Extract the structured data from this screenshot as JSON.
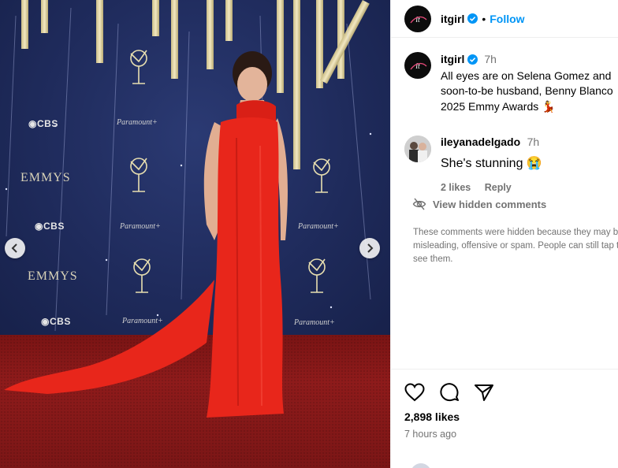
{
  "post": {
    "username": "itgirl",
    "follow_label": "Follow",
    "separator": "•",
    "caption_time": "7h",
    "caption_lines": [
      "All eyes are on Selena Gomez and",
      "soon-to-be husband, Benny Blanco",
      "2025 Emmy Awards 💃"
    ],
    "likes": "2,898 likes",
    "posted_ago": "7 hours ago"
  },
  "comment": {
    "username": "ileyanadelgado",
    "time": "7h",
    "text": "She's stunning 😭",
    "likes": "2 likes",
    "reply": "Reply"
  },
  "hidden": {
    "label": "View hidden comments",
    "note": "These comments were hidden because they may be misleading, offensive or spam. People can still tap to see them."
  },
  "photo": {
    "logos": {
      "cbs": "CBS",
      "emmys": "EMMYS",
      "paramount": "Paramount+"
    }
  },
  "icons": {
    "verified": "verified-badge-icon",
    "heart": "heart-icon",
    "comment": "comment-bubble-icon",
    "share": "share-paper-plane-icon",
    "eye_slash": "eye-slash-icon",
    "prev": "chevron-left-icon",
    "next": "chevron-right-icon"
  },
  "colors": {
    "follow_blue": "#0095f6",
    "verified_blue": "#0095f6",
    "muted_text": "#737373",
    "dress_red": "#e8261b"
  }
}
